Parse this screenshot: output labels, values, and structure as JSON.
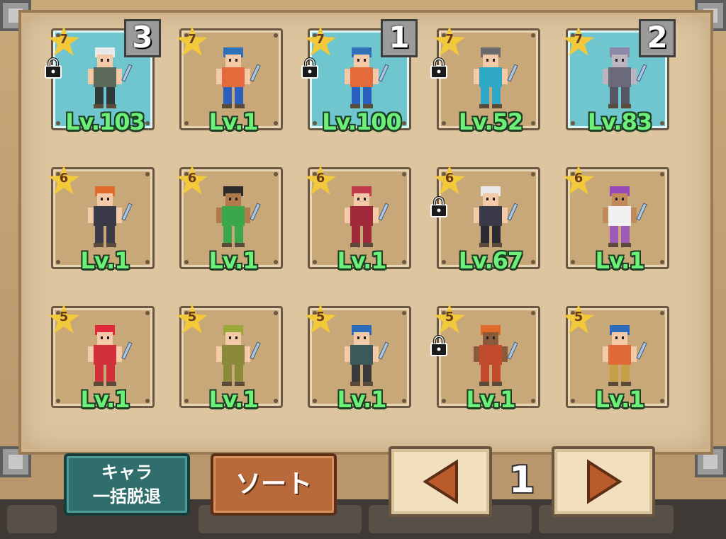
{
  "characters": [
    {
      "stars": "7",
      "level": "Lv.103",
      "locked": true,
      "rank": "3",
      "selected": true,
      "hair": "#e8e8e8",
      "top": "#5c6a5a",
      "pants": "#2f3a3a",
      "skin": "#f3c9a8"
    },
    {
      "stars": "7",
      "level": "Lv.1",
      "locked": false,
      "rank": "",
      "selected": false,
      "hair": "#2f6fb8",
      "top": "#e36a3a",
      "pants": "#2a5fc0",
      "skin": "#f3c9a8"
    },
    {
      "stars": "7",
      "level": "Lv.100",
      "locked": true,
      "rank": "1",
      "selected": true,
      "hair": "#2f6fb8",
      "top": "#e36a3a",
      "pants": "#2a5fc0",
      "skin": "#f3c9a8"
    },
    {
      "stars": "7",
      "level": "Lv.52",
      "locked": true,
      "rank": "",
      "selected": false,
      "hair": "#6b6b6b",
      "top": "#2fa8c8",
      "pants": "#2fa8c8",
      "skin": "#f3c9a8"
    },
    {
      "stars": "7",
      "level": "Lv.83",
      "locked": false,
      "rank": "2",
      "selected": true,
      "hair": "#8a8aa8",
      "top": "#6a6a7a",
      "pants": "#555566",
      "skin": "#bdb4c0"
    },
    {
      "stars": "6",
      "level": "Lv.1",
      "locked": false,
      "rank": "",
      "selected": false,
      "hair": "#e06a2a",
      "top": "#3a3a48",
      "pants": "#3a3a48",
      "skin": "#f3c9a8"
    },
    {
      "stars": "6",
      "level": "Lv.1",
      "locked": false,
      "rank": "",
      "selected": false,
      "hair": "#2a2a2a",
      "top": "#3aa84a",
      "pants": "#3aa84a",
      "skin": "#b07a4a"
    },
    {
      "stars": "6",
      "level": "Lv.1",
      "locked": false,
      "rank": "",
      "selected": false,
      "hair": "#c03a4a",
      "top": "#a02a3a",
      "pants": "#a02a3a",
      "skin": "#f3c9a8"
    },
    {
      "stars": "6",
      "level": "Lv.67",
      "locked": true,
      "rank": "",
      "selected": false,
      "hair": "#e8e8e8",
      "top": "#3a3a48",
      "pants": "#2a2a32",
      "skin": "#f3c9a8"
    },
    {
      "stars": "6",
      "level": "Lv.1",
      "locked": false,
      "rank": "",
      "selected": false,
      "hair": "#9a4ab8",
      "top": "#f0f0f0",
      "pants": "#a05ab8",
      "skin": "#c08a5a"
    },
    {
      "stars": "5",
      "level": "Lv.1",
      "locked": false,
      "rank": "",
      "selected": false,
      "hair": "#e02a3a",
      "top": "#d0303a",
      "pants": "#d0303a",
      "skin": "#f3c9a8"
    },
    {
      "stars": "5",
      "level": "Lv.1",
      "locked": false,
      "rank": "",
      "selected": false,
      "hair": "#9aa83a",
      "top": "#8a8a3a",
      "pants": "#8a8a3a",
      "skin": "#f3c9a8"
    },
    {
      "stars": "5",
      "level": "Lv.1",
      "locked": false,
      "rank": "",
      "selected": false,
      "hair": "#2a6ab8",
      "top": "#3a5a5a",
      "pants": "#3a3a3a",
      "skin": "#f3c9a8"
    },
    {
      "stars": "5",
      "level": "Lv.1",
      "locked": true,
      "rank": "",
      "selected": false,
      "hair": "#e06a2a",
      "top": "#c04a2a",
      "pants": "#c04a2a",
      "skin": "#8a5a3a"
    },
    {
      "stars": "5",
      "level": "Lv.1",
      "locked": false,
      "rank": "",
      "selected": false,
      "hair": "#2a6ab8",
      "top": "#e06a3a",
      "pants": "#c8a04a",
      "skin": "#f3c9a8"
    }
  ],
  "buttons": {
    "release_line1": "キャラ",
    "release_line2": "一括脱退",
    "sort": "ソート"
  },
  "pagination": {
    "current_page": "1",
    "prev_icon": "left-triangle-icon",
    "next_icon": "right-triangle-icon"
  },
  "colors": {
    "level_text": "#6df07a",
    "star": "#f2c93a",
    "selected_card": "#6fc6cf",
    "card": "#c8a779"
  }
}
